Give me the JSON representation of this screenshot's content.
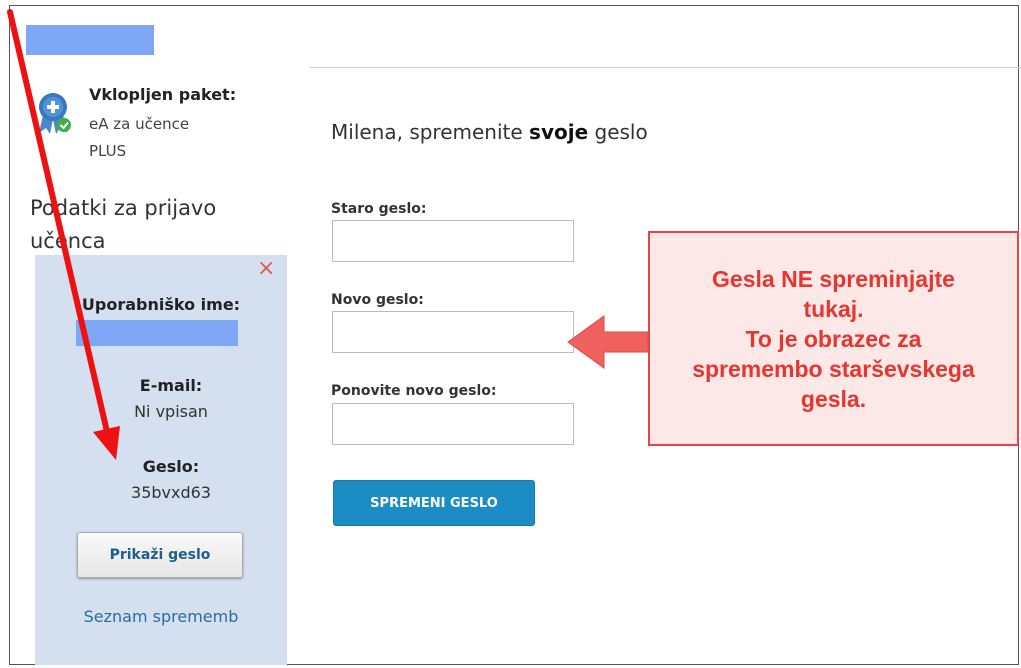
{
  "package": {
    "title": "Vklopljen paket:",
    "line1": "eA za učence",
    "line2": "PLUS",
    "icon": "award-ribbon-icon"
  },
  "login_panel": {
    "heading_line1": "Podatki za prijavo",
    "heading_line2": "učenca",
    "username_label": "Uporabniško ime:",
    "email_label": "E-mail:",
    "email_value": "Ni vpisan",
    "password_label": "Geslo:",
    "password_value": "35bvxd63",
    "show_password_button": "Prikaži geslo",
    "changes_link": "Seznam sprememb",
    "close_symbol": "×"
  },
  "form": {
    "title_prefix": "Milena, spremenite ",
    "title_bold": "svoje",
    "title_suffix": " geslo",
    "old_password_label": "Staro geslo:",
    "new_password_label": "Novo geslo:",
    "repeat_password_label": "Ponovite novo geslo:",
    "old_password_value": "",
    "new_password_value": "",
    "repeat_password_value": "",
    "submit_button": "SPREMENI GESLO"
  },
  "annotation": {
    "line1": "Gesla NE spreminjajte",
    "line2": "tukaj.",
    "line3": "To je obrazec za",
    "line4": "spremembo starševskega",
    "line5": "gesla."
  },
  "colors": {
    "accent_button": "#1b8cc4",
    "panel_bg": "#d4dff0",
    "warning_red": "#e5362f",
    "redaction_blue": "#7ea8f5"
  }
}
